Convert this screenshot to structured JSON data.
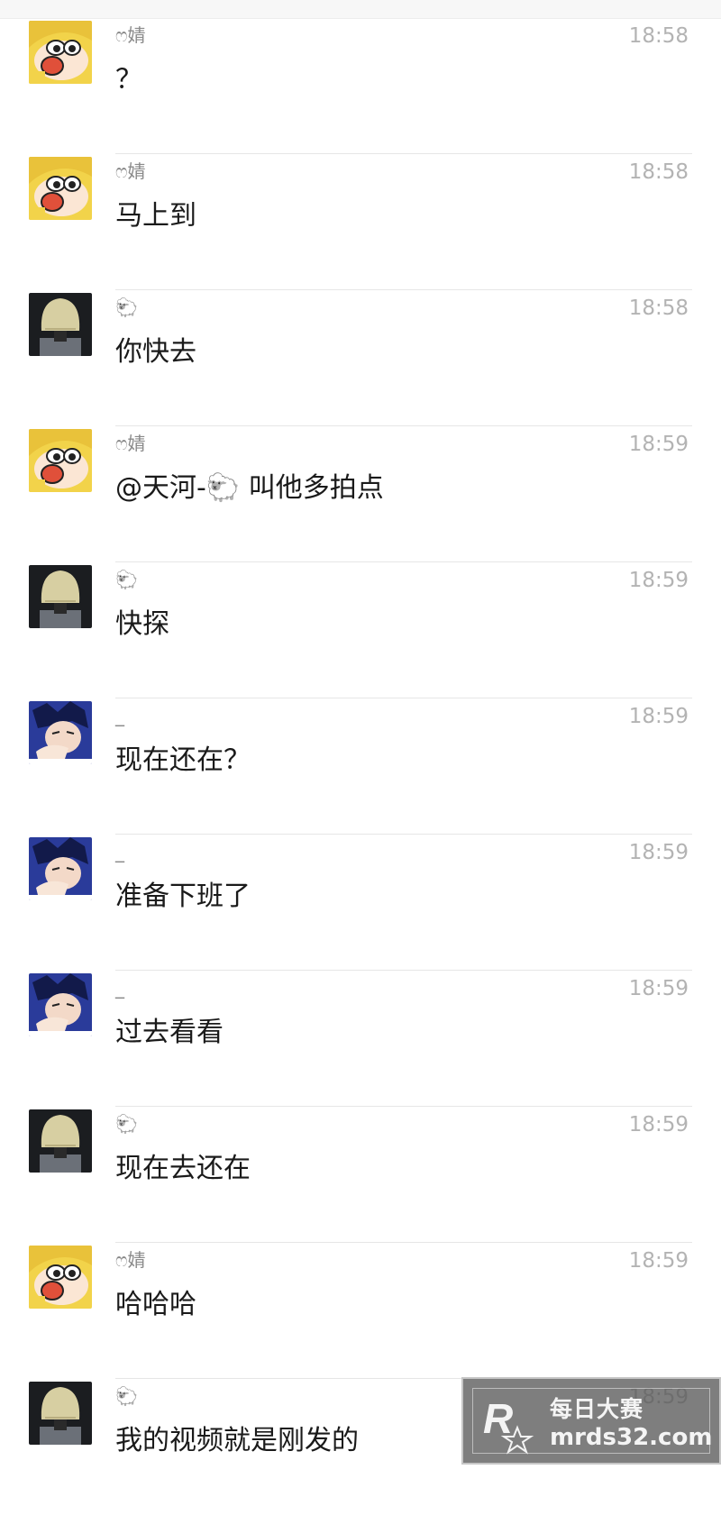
{
  "messages": [
    {
      "sender": "ෆ婧",
      "avatar": "crayon-shin-chan-avatar",
      "time": "18:58",
      "text": "？"
    },
    {
      "sender": "ෆ婧",
      "avatar": "crayon-shin-chan-avatar",
      "time": "18:58",
      "text": "马上到"
    },
    {
      "sender": "🐑",
      "avatar": "blonde-hair-avatar",
      "time": "18:58",
      "text": "你快去"
    },
    {
      "sender": "ෆ婧",
      "avatar": "crayon-shin-chan-avatar",
      "time": "18:59",
      "text": "@天河-🐑 叫他多拍点"
    },
    {
      "sender": "🐑",
      "avatar": "blonde-hair-avatar",
      "time": "18:59",
      "text": "快探"
    },
    {
      "sender": "_",
      "avatar": "anime-boy-avatar",
      "time": "18:59",
      "text": "现在还在？"
    },
    {
      "sender": "_",
      "avatar": "anime-boy-avatar",
      "time": "18:59",
      "text": "准备下班了"
    },
    {
      "sender": "_",
      "avatar": "anime-boy-avatar",
      "time": "18:59",
      "text": "过去看看"
    },
    {
      "sender": "🐑",
      "avatar": "blonde-hair-avatar",
      "time": "18:59",
      "text": "现在去还在"
    },
    {
      "sender": "ෆ婧",
      "avatar": "crayon-shin-chan-avatar",
      "time": "18:59",
      "text": "哈哈哈"
    },
    {
      "sender": "🐑",
      "avatar": "blonde-hair-avatar",
      "time": "18:59",
      "text": "我的视频就是刚发的"
    }
  ],
  "watermark": {
    "title": "每日大赛",
    "domain": "mrds32.com",
    "logo_letter": "R"
  }
}
